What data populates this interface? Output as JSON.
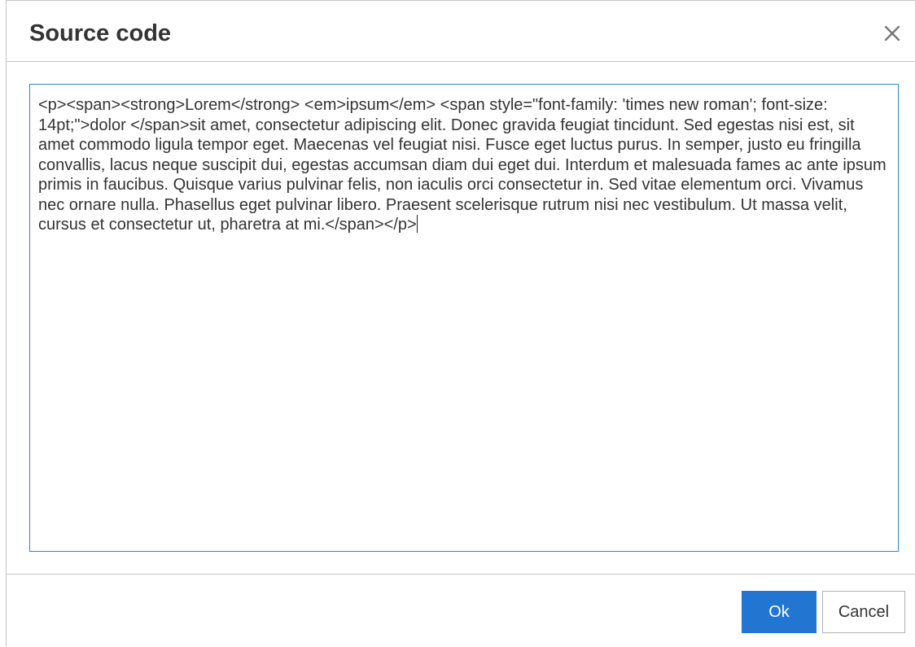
{
  "dialog": {
    "title": "Source code",
    "close_icon": "close-icon"
  },
  "editor": {
    "value": "<p><span><strong>Lorem</strong> <em>ipsum</em> <span style=\"font-family: 'times new roman'; font-size: 14pt;\">dolor </span>sit amet, consectetur adipiscing elit. Donec gravida feugiat tincidunt. Sed egestas nisi est, sit amet commodo ligula tempor eget. Maecenas vel feugiat nisi. Fusce eget luctus purus. In semper, justo eu fringilla convallis, lacus neque suscipit dui, egestas accumsan diam dui eget dui. Interdum et malesuada fames ac ante ipsum primis in faucibus. Quisque varius pulvinar felis, non iaculis orci consectetur in. Sed vitae elementum orci. Vivamus nec ornare nulla. Phasellus eget pulvinar libero. Praesent scelerisque rutrum nisi nec vestibulum. Ut massa velit, cursus et consectetur ut, pharetra at mi.</span></p>"
  },
  "footer": {
    "ok_label": "Ok",
    "cancel_label": "Cancel"
  },
  "colors": {
    "accent": "#2276d2",
    "focus_border": "#2d8ac7",
    "text": "#333333",
    "divider": "#c5c5c5"
  }
}
